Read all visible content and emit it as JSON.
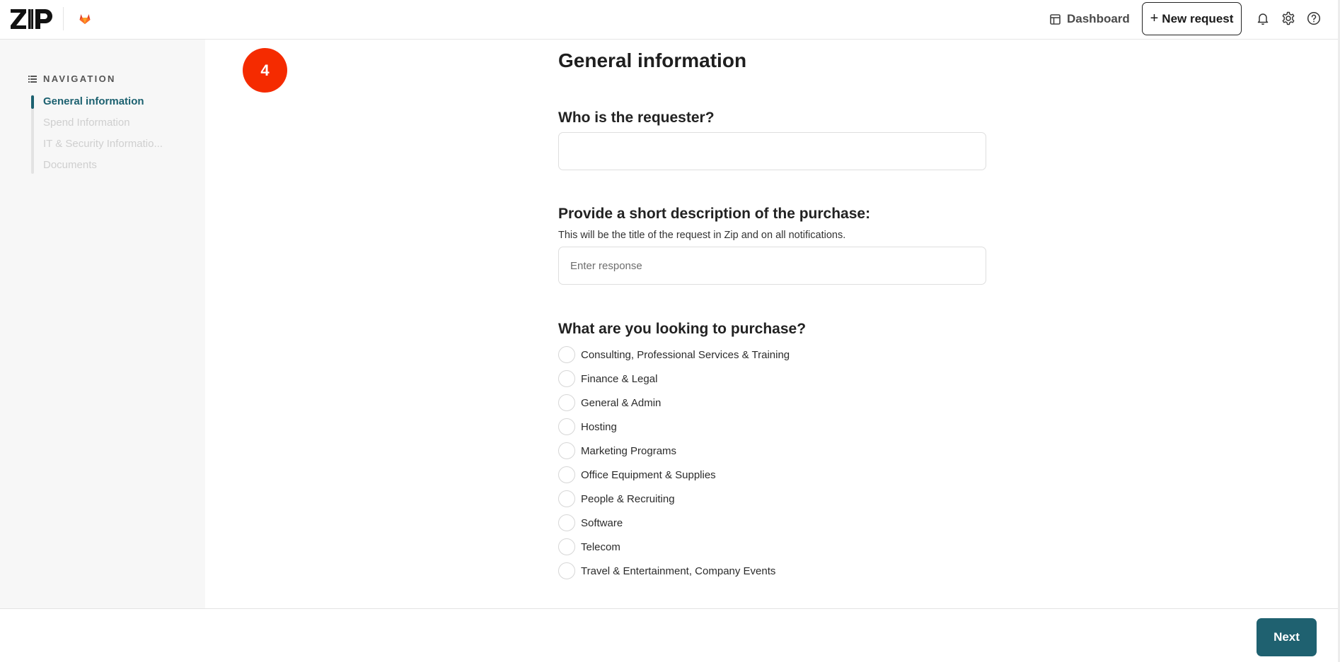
{
  "header": {
    "logo_text": "ZIP",
    "dashboard_label": "Dashboard",
    "new_request_label": "New request",
    "new_request_icon": "+",
    "icons": [
      "bell-icon",
      "gear-icon",
      "help-icon"
    ]
  },
  "sidebar": {
    "heading": "NAVIGATION",
    "items": [
      {
        "label": "General information",
        "active": true
      },
      {
        "label": "Spend Information",
        "active": false
      },
      {
        "label": "IT & Security Informatio...",
        "active": false
      },
      {
        "label": "Documents",
        "active": false
      }
    ]
  },
  "step_badge": "4",
  "form": {
    "title": "General information",
    "requester": {
      "label": "Who is the requester?",
      "value": "",
      "placeholder": ""
    },
    "description": {
      "label": "Provide a short description of the purchase:",
      "help": "This will be the title of the request in Zip and on all notifications.",
      "value": "",
      "placeholder": "Enter response"
    },
    "purchase_type": {
      "label": "What are you looking to purchase?",
      "options": [
        "Consulting, Professional Services & Training",
        "Finance & Legal",
        "General & Admin",
        "Hosting",
        "Marketing Programs",
        "Office Equipment & Supplies",
        "People & Recruiting",
        "Software",
        "Telecom",
        "Travel & Entertainment, Company Events"
      ],
      "selected": null
    }
  },
  "footer": {
    "next_label": "Next"
  },
  "colors": {
    "accent": "#1f6170",
    "badge": "#f52b00"
  }
}
